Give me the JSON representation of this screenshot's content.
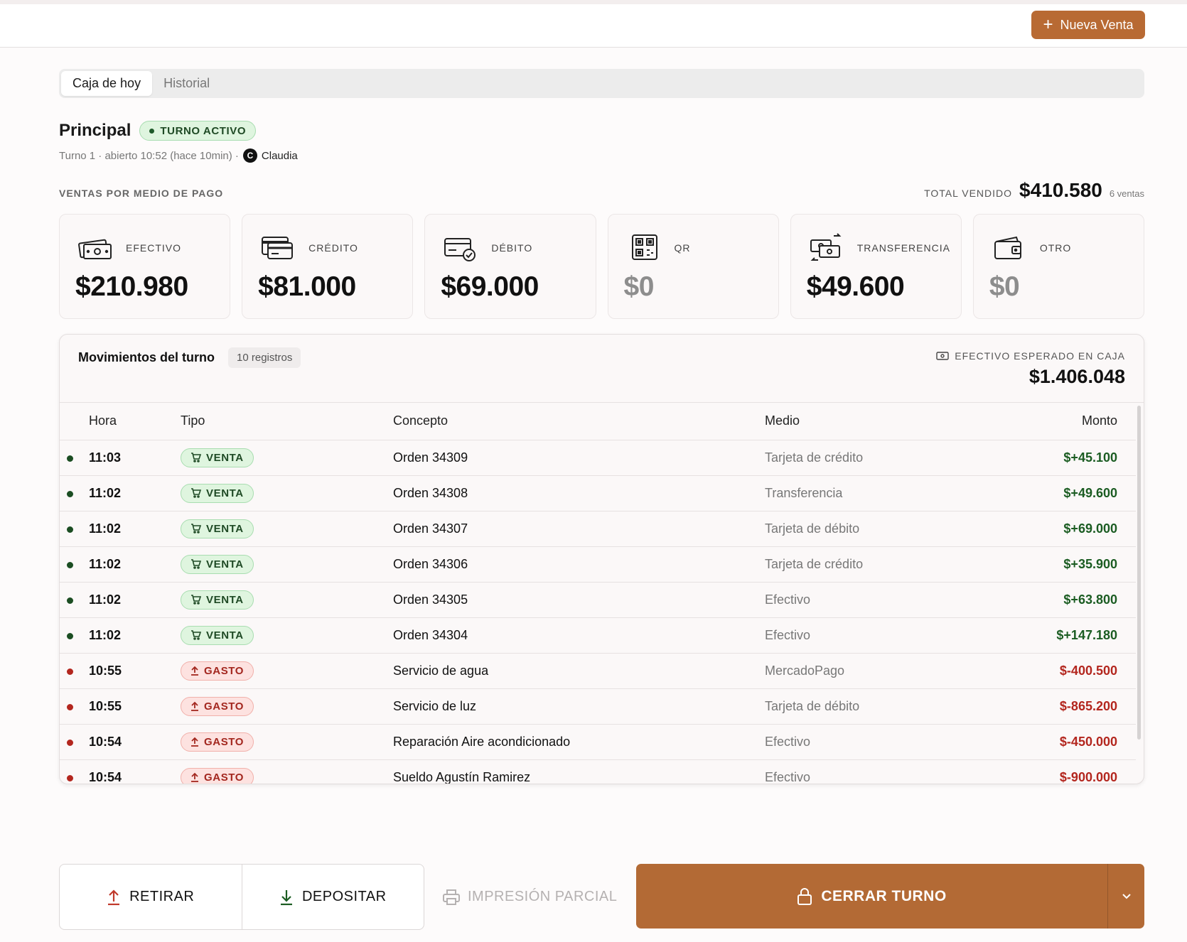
{
  "header": {
    "new_sale_label": "Nueva Venta"
  },
  "tabs": [
    {
      "label": "Caja de hoy"
    },
    {
      "label": "Historial"
    }
  ],
  "register": {
    "name": "Principal",
    "status": "TURNO ACTIVO",
    "shift_info": "Turno 1 · abierto 10:52 (hace 10min) ·",
    "user_initial": "C",
    "user_name": "Claudia"
  },
  "sales": {
    "section_label": "VENTAS POR MEDIO DE PAGO",
    "total_label": "TOTAL VENDIDO",
    "total_value": "$410.580",
    "total_count": "6 ventas",
    "methods": [
      {
        "label": "EFECTIVO",
        "value": "$210.980",
        "icon": "cash-icon"
      },
      {
        "label": "CRÉDITO",
        "value": "$81.000",
        "icon": "credit-card-icon"
      },
      {
        "label": "DÉBITO",
        "value": "$69.000",
        "icon": "debit-card-icon"
      },
      {
        "label": "QR",
        "value": "$0",
        "icon": "qr-code-icon"
      },
      {
        "label": "TRANSFERENCIA",
        "value": "$49.600",
        "icon": "transfer-icon"
      },
      {
        "label": "OTRO",
        "value": "$0",
        "icon": "wallet-icon"
      }
    ]
  },
  "movements": {
    "title": "Movimientos del turno",
    "count": "10 registros",
    "expected_label": "EFECTIVO ESPERADO EN CAJA",
    "expected_value": "$1.406.048",
    "columns": {
      "hora": "Hora",
      "tipo": "Tipo",
      "concepto": "Concepto",
      "medio": "Medio",
      "monto": "Monto"
    },
    "rows": [
      {
        "hora": "11:03",
        "tipo": "VENTA",
        "concepto": "Orden 34309",
        "medio": "Tarjeta de crédito",
        "monto": "$+45.100"
      },
      {
        "hora": "11:02",
        "tipo": "VENTA",
        "concepto": "Orden 34308",
        "medio": "Transferencia",
        "monto": "$+49.600"
      },
      {
        "hora": "11:02",
        "tipo": "VENTA",
        "concepto": "Orden 34307",
        "medio": "Tarjeta de débito",
        "monto": "$+69.000"
      },
      {
        "hora": "11:02",
        "tipo": "VENTA",
        "concepto": "Orden 34306",
        "medio": "Tarjeta de crédito",
        "monto": "$+35.900"
      },
      {
        "hora": "11:02",
        "tipo": "VENTA",
        "concepto": "Orden 34305",
        "medio": "Efectivo",
        "monto": "$+63.800"
      },
      {
        "hora": "11:02",
        "tipo": "VENTA",
        "concepto": "Orden 34304",
        "medio": "Efectivo",
        "monto": "$+147.180"
      },
      {
        "hora": "10:55",
        "tipo": "GASTO",
        "concepto": "Servicio de agua",
        "medio": "MercadoPago",
        "monto": "$-400.500"
      },
      {
        "hora": "10:55",
        "tipo": "GASTO",
        "concepto": "Servicio de luz",
        "medio": "Tarjeta de débito",
        "monto": "$-865.200"
      },
      {
        "hora": "10:54",
        "tipo": "GASTO",
        "concepto": "Reparación Aire acondicionado",
        "medio": "Efectivo",
        "monto": "$-450.000"
      },
      {
        "hora": "10:54",
        "tipo": "GASTO",
        "concepto": "Sueldo Agustín Ramirez",
        "medio": "Efectivo",
        "monto": "$-900.000"
      }
    ]
  },
  "actions": {
    "withdraw": "RETIRAR",
    "deposit": "DEPOSITAR",
    "partial_print": "IMPRESIÓN PARCIAL",
    "close_shift": "CERRAR TURNO"
  },
  "colors": {
    "accent": "#b86a33",
    "positive": "#1b5c22",
    "negative": "#b3261e"
  }
}
